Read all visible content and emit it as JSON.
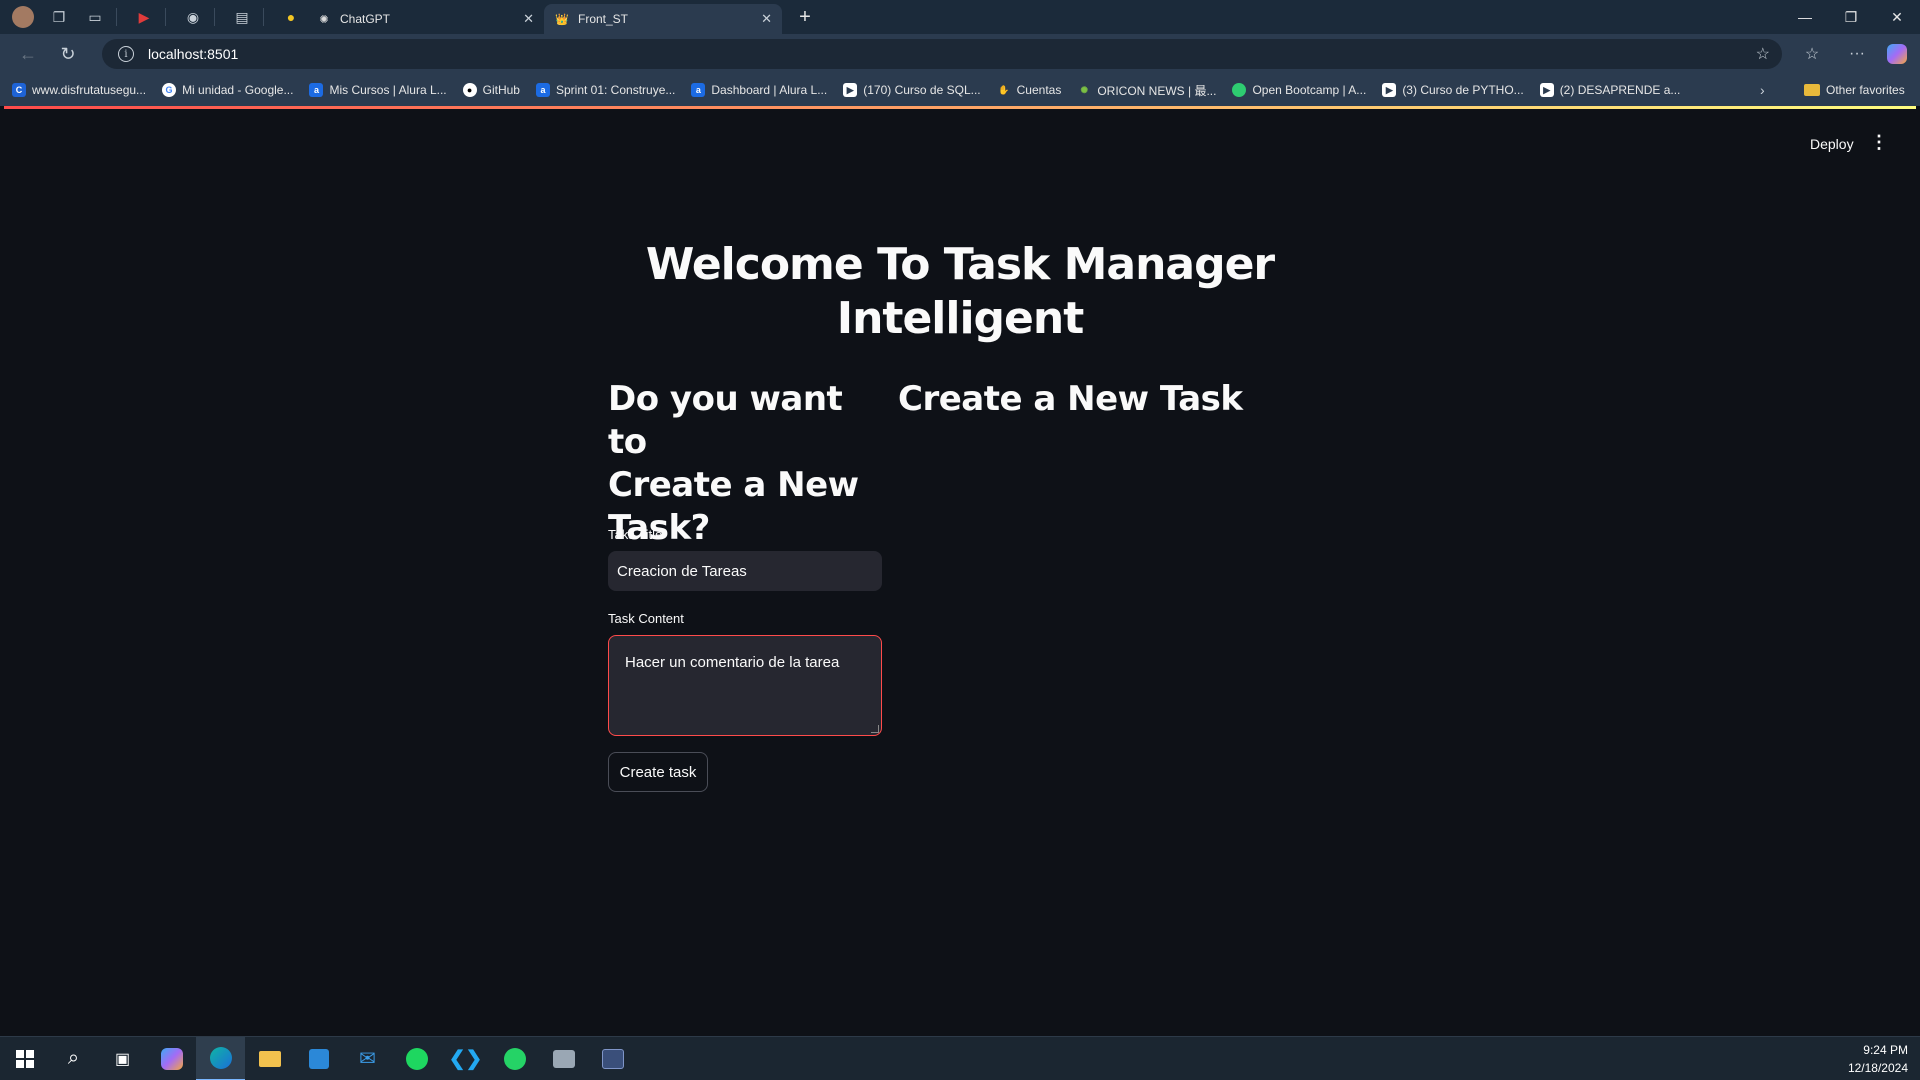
{
  "browser": {
    "tabs": [
      {
        "title": "ChatGPT",
        "favicon": "chatgpt-icon",
        "active": false
      },
      {
        "title": "Front_ST",
        "favicon": "streamlit-icon",
        "active": true
      }
    ],
    "address": "localhost:8501",
    "bookmarks": [
      {
        "label": "www.disfrutatusegu...",
        "icon": "c-icon",
        "color": "#1e63d6"
      },
      {
        "label": "Mi unidad - Google...",
        "icon": "google-icon",
        "color": "#ffffff"
      },
      {
        "label": "Mis Cursos | Alura L...",
        "icon": "alura-icon",
        "color": "#1c6be3"
      },
      {
        "label": "GitHub",
        "icon": "github-icon",
        "color": "#ffffff"
      },
      {
        "label": "Sprint 01: Construye...",
        "icon": "alura-icon",
        "color": "#1c6be3"
      },
      {
        "label": "Dashboard | Alura L...",
        "icon": "alura-icon",
        "color": "#1c6be3"
      },
      {
        "label": "(170) Curso de SQL...",
        "icon": "youtube-icon",
        "color": "#ffffff"
      },
      {
        "label": "Cuentas",
        "icon": "hand-icon",
        "color": "#d9a066"
      },
      {
        "label": "ORICON NEWS | 最...",
        "icon": "oricon-icon",
        "color": "#7bc043"
      },
      {
        "label": "Open Bootcamp | A...",
        "icon": "openbootcamp-icon",
        "color": "#2ecc71"
      },
      {
        "label": "(3) Curso de PYTHO...",
        "icon": "youtube-icon",
        "color": "#ffffff"
      },
      {
        "label": "(2) DESAPRENDE a...",
        "icon": "youtube-icon",
        "color": "#ffffff"
      }
    ],
    "other_favorites": "Other favorites"
  },
  "app": {
    "deploy_label": "Deploy",
    "title_line1": "Welcome To Task Manager",
    "title_line2": "Intelligent",
    "left_heading_1": "Do you want to",
    "left_heading_2": "Create a New",
    "left_heading_3": "Task?",
    "right_heading": "Create a New Task",
    "title_label": "Taks Title",
    "title_value": "Creacion de Tareas",
    "content_label": "Task Content",
    "content_value": "Hacer un comentario de la tarea",
    "button_label": "Create task"
  },
  "taskbar": {
    "time": "9:24 PM",
    "date": "12/18/2024"
  }
}
